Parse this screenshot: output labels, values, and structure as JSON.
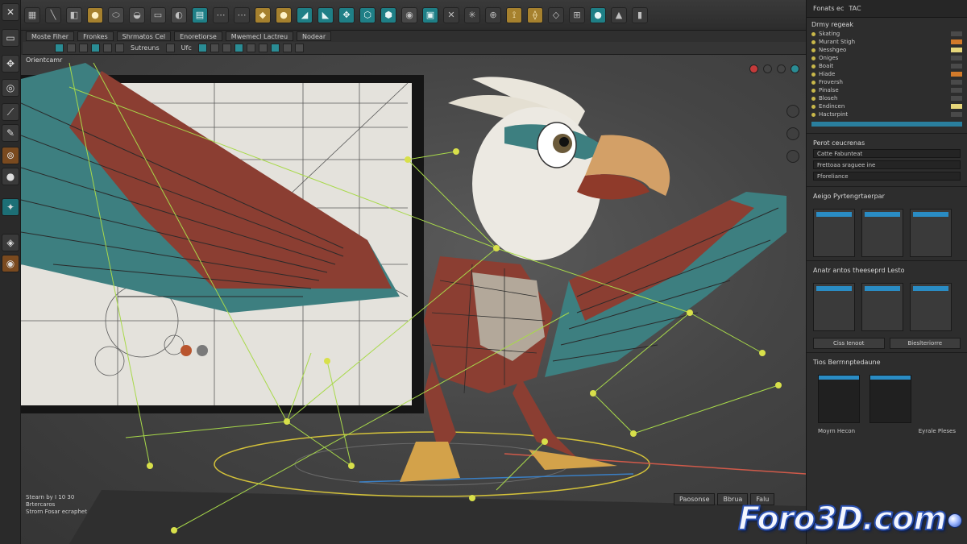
{
  "viewport": {
    "label": "Orientcamr",
    "hud_line_1": "Stearn by I 10 30",
    "hud_line_2": "Brtercaros",
    "hud_line_3": "Strorn Fosar ecraphet"
  },
  "tabs": [
    "Moste Fiher",
    "Fronkes",
    "Shrmatos Cel",
    "Enoretiorse",
    "Mwemecl Lactreu",
    "Nodear"
  ],
  "tool_strip": {
    "label_1": "Sutreuns",
    "label_2": "Ufc"
  },
  "top_right": {
    "file_label": "Fonats ec",
    "tag": "TAC"
  },
  "outliner": {
    "title": "Drmy regeak",
    "rows": [
      "Skating",
      "Murant Stigh",
      "Nesshgeo",
      "Oniges",
      "Boait",
      "Hiade",
      "Froversh",
      "Pinalse",
      "Bloseh",
      "Endincen",
      "Hactsrpint"
    ]
  },
  "attr": {
    "section_1": "Perot ceucrenas",
    "field_1": "Catte Fabunteat",
    "field_2": "Frettoaa sraguee ine",
    "field_3": "Fforeliance",
    "section_2": "Aeigo Pyrtengrtaerpar",
    "section_3": "Anatr antos theeseprd Lesto",
    "btn_1": "Ciss Ienoot",
    "btn_2": "Bieslteriorre",
    "section_4": "Tios Berrnnptedaune",
    "graph_label_1": "Moyrn Hecon",
    "graph_label_2": "Eyrale Pleses"
  },
  "timeline_tabs": [
    "Paosonse",
    "Bbrua",
    "Falu"
  ],
  "watermark": "Foro3D.com"
}
